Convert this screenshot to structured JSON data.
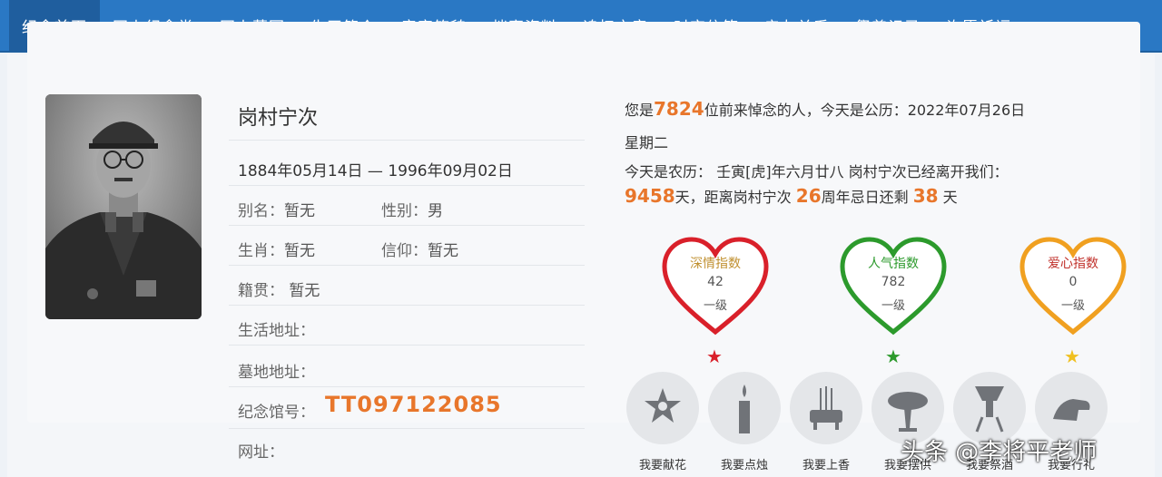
{
  "nav": {
    "items": [
      "纪念首页",
      "网上纪念堂",
      "网上墓园",
      "生平简介",
      "音容笑貌",
      "档案资料",
      "追忆文章",
      "时空信箱",
      "亲友关系",
      "祭奠记录",
      "许愿祈福"
    ]
  },
  "profile": {
    "name": "岗村宁次",
    "dates": "1884年05月14日 — 1996年09月02日",
    "alias_label": "别名：",
    "alias_value": "暂无",
    "gender_label": "性别：",
    "gender_value": "男",
    "zodiac_label": "生肖：",
    "zodiac_value": "暂无",
    "belief_label": "信仰：",
    "belief_value": "暂无",
    "hometown_label": "籍贯：",
    "hometown_value": "暂无",
    "address_label": "生活地址：",
    "grave_label": "墓地地址：",
    "memorial_label": "纪念馆号：",
    "memorial_value": "TT097122085",
    "website_label": "网址："
  },
  "info": {
    "p1": "您是",
    "visitors": "7824",
    "p2": "位前来悼念的人，今天是公历：2022年07月26日",
    "weekday": "星期二",
    "lunar": "今天是农历： 壬寅[虎]年六月廿八 岗村宁次已经离开我们：",
    "days_gone": "9458",
    "p3": "天，距离岗村宁次",
    "anniv": "26",
    "p4": "周年忌日还剩",
    "days_left": "38",
    "p5": "天"
  },
  "hearts": [
    {
      "title": "深情指数",
      "value": "42",
      "level": "一级",
      "color": "#d9202a",
      "text_color": "#c09030"
    },
    {
      "title": "人气指数",
      "value": "782",
      "level": "一级",
      "color": "#2c9a2c",
      "text_color": "#2c9a2c"
    },
    {
      "title": "爱心指数",
      "value": "0",
      "level": "一级",
      "color": "#f0a020",
      "text_color": "#c0302a"
    }
  ],
  "actions": [
    "我要献花",
    "我要点烛",
    "我要上香",
    "我要摆供",
    "我要祭酒",
    "我要行礼"
  ],
  "watermark": "头条 @李将平老师"
}
